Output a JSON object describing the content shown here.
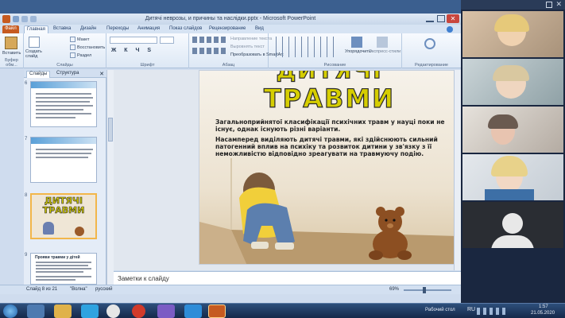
{
  "window": {
    "title": "Дитячі неврозы, и причины та наслідки.pptx - Microsoft PowerPoint"
  },
  "ribbon": {
    "tabs": [
      "Файл",
      "Главная",
      "Вставка",
      "Дизайн",
      "Переходы",
      "Анимация",
      "Показ слайдов",
      "Рецензирование",
      "Вид"
    ],
    "active_tab": "Главная",
    "groups": {
      "clipboard": {
        "label": "Буфер обм...",
        "paste": "Вставить"
      },
      "slides": {
        "label": "Слайды",
        "new_slide": "Создать слайд",
        "layout": "Макет",
        "reset": "Восстановить",
        "section": "Раздел"
      },
      "font": {
        "label": "Шрифт"
      },
      "paragraph": {
        "label": "Абзац",
        "text_direction": "Направление текста",
        "align_text": "Выровнять текст",
        "smartart": "Преобразовать в SmartArt"
      },
      "drawing": {
        "label": "Рисование",
        "arrange": "Упорядочить",
        "quick_styles": "Экспресс-стили"
      },
      "editing": {
        "label": "Редактирование"
      }
    }
  },
  "left_pane": {
    "tabs": [
      "Слайды",
      "Структура"
    ],
    "thumbnail_numbers": [
      "6",
      "7",
      "8",
      "9"
    ],
    "thumb8_title_line1": "ДИТЯЧІ",
    "thumb8_title_line2": "ТРАВМИ",
    "thumb9_heading": "Прояви травми у дітей"
  },
  "slide": {
    "title_top": "ДИТЯЧІ",
    "title_bottom": "ТРАВМИ",
    "paragraph1": "Загальноприйнятої класифікації психічних травм у науці поки не існує, однак існують різні варіанти.",
    "paragraph2": "Насамперед виділяють дитячі травми, які здійснюють сильний патогенний вплив на психіку та розвиток дитини у  зв'язку з її неможливістю відповідно зреагувати на травмуючу подію."
  },
  "notes": {
    "placeholder": "Заметки к слайду"
  },
  "status_bar": {
    "slide_info": "Слайд 8 из 21",
    "theme": "\"Волна\"",
    "language": "русский",
    "zoom": "69%"
  },
  "video_panel": {
    "participants": 5
  },
  "taskbar": {
    "desktop_label": "Рабочий стол",
    "language": "RU",
    "time": "1:57",
    "date": "21.05.2020"
  },
  "colors": {
    "title_fill": "#d6ce00",
    "file_tab": "#c65a20",
    "selected_thumb": "#f2b64a",
    "taskbar": "#1e3a63"
  }
}
